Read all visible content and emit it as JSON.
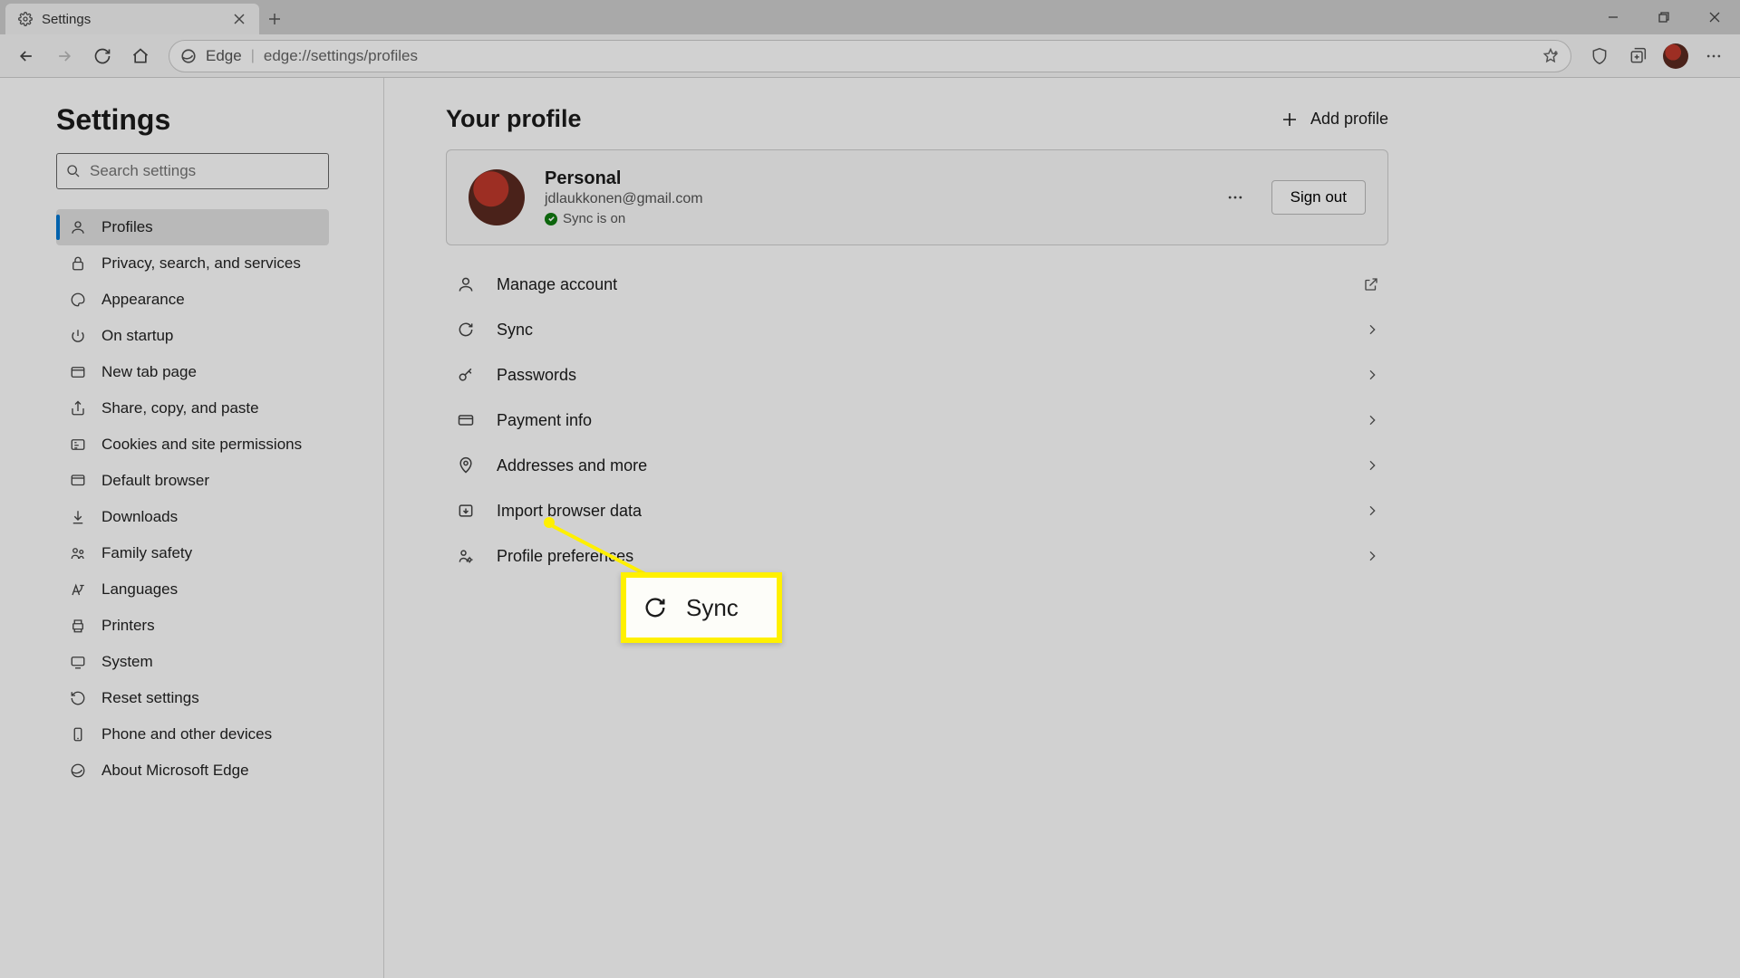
{
  "tab": {
    "title": "Settings"
  },
  "address": {
    "label": "Edge",
    "url": "edge://settings/profiles"
  },
  "sidebar": {
    "title": "Settings",
    "search_placeholder": "Search settings",
    "items": [
      {
        "label": "Profiles"
      },
      {
        "label": "Privacy, search, and services"
      },
      {
        "label": "Appearance"
      },
      {
        "label": "On startup"
      },
      {
        "label": "New tab page"
      },
      {
        "label": "Share, copy, and paste"
      },
      {
        "label": "Cookies and site permissions"
      },
      {
        "label": "Default browser"
      },
      {
        "label": "Downloads"
      },
      {
        "label": "Family safety"
      },
      {
        "label": "Languages"
      },
      {
        "label": "Printers"
      },
      {
        "label": "System"
      },
      {
        "label": "Reset settings"
      },
      {
        "label": "Phone and other devices"
      },
      {
        "label": "About Microsoft Edge"
      }
    ]
  },
  "main": {
    "title": "Your profile",
    "add_profile": "Add profile",
    "profile": {
      "name": "Personal",
      "email": "jdlaukkonen@gmail.com",
      "sync_status": "Sync is on",
      "signout": "Sign out"
    },
    "options": [
      {
        "label": "Manage account",
        "right": "external"
      },
      {
        "label": "Sync",
        "right": "chevron"
      },
      {
        "label": "Passwords",
        "right": "chevron"
      },
      {
        "label": "Payment info",
        "right": "chevron"
      },
      {
        "label": "Addresses and more",
        "right": "chevron"
      },
      {
        "label": "Import browser data",
        "right": "chevron"
      },
      {
        "label": "Profile preferences",
        "right": "chevron"
      }
    ]
  },
  "callout": {
    "label": "Sync"
  }
}
